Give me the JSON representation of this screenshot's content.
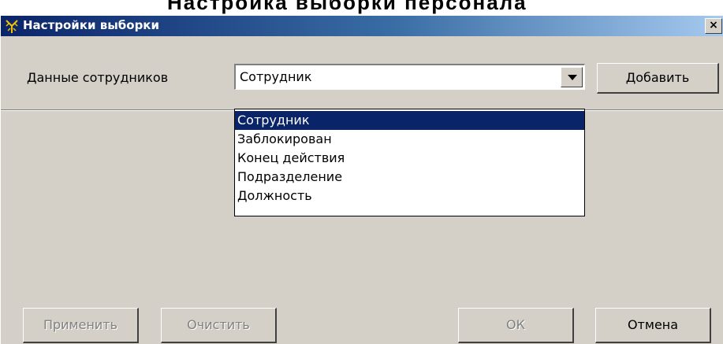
{
  "heading": "Настройка выборки персонала",
  "window": {
    "title": "Настройки выборки",
    "close_glyph": "×",
    "icon": "app-antenna-icon"
  },
  "filter": {
    "label": "Данные сотрудников",
    "selected_value": "Сотрудник",
    "add_label": "Добавить",
    "options": [
      "Сотрудник",
      "Заблокирован",
      "Конец действия",
      "Подразделение",
      "Должность"
    ],
    "highlighted_index": 0
  },
  "footer": {
    "apply_label": "Применить",
    "clear_label": "Очистить",
    "ok_label": "ОК",
    "cancel_label": "Отмена"
  },
  "colors": {
    "titlebar_start": "#0a246a",
    "titlebar_end": "#a6caf0",
    "selection": "#0a246a",
    "face": "#d4d0c8"
  }
}
